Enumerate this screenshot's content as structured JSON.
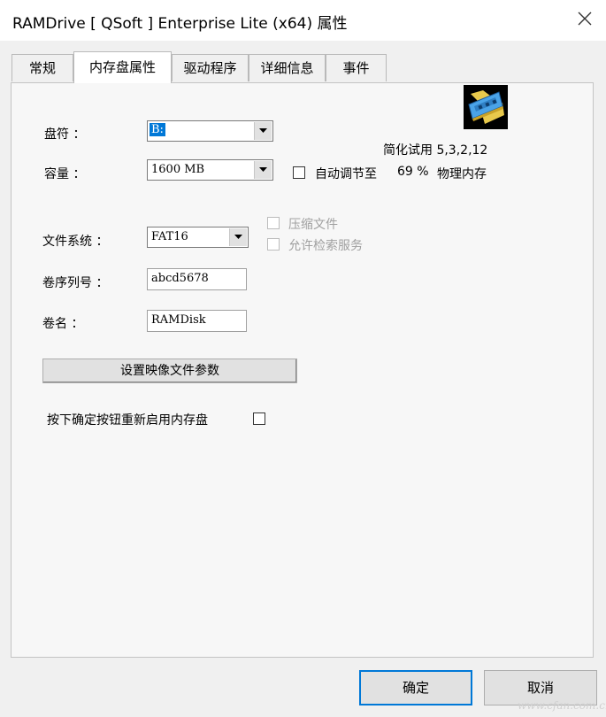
{
  "window": {
    "title": "RAMDrive [ QSoft ] Enterprise Lite (x64) 属性"
  },
  "tabs": [
    {
      "label": "常规",
      "active": false
    },
    {
      "label": "内存盘属性",
      "active": true
    },
    {
      "label": "驱动程序",
      "active": false
    },
    {
      "label": "详细信息",
      "active": false
    },
    {
      "label": "事件",
      "active": false
    }
  ],
  "panel": {
    "trial_label": "简化试用 5,3,2,12",
    "drive_letter": {
      "label": "盘符 ：",
      "value": "B:"
    },
    "capacity": {
      "label": "容量 ：",
      "value": "1600 MB"
    },
    "auto_adjust": {
      "label": "自动调节至",
      "percent": "69 %",
      "suffix": "物理内存",
      "checked": false
    },
    "filesystem": {
      "label": "文件系统 ：",
      "value": "FAT16"
    },
    "compress": {
      "label": "压缩文件",
      "checked": false,
      "enabled": false
    },
    "indexing": {
      "label": "允许检索服务",
      "checked": false,
      "enabled": false
    },
    "serial": {
      "label": "卷序列号 ：",
      "value": "abcd5678"
    },
    "volume_name": {
      "label": "卷名 ：",
      "value": "RAMDisk"
    },
    "image_button_label": "设置映像文件参数",
    "restart_label": "按下确定按钮重新启用内存盘",
    "restart_checked": false
  },
  "footer": {
    "ok_label": "确定",
    "cancel_label": "取消"
  },
  "watermark": "www.cfan.com.cn",
  "colors": {
    "accent": "#0078d7",
    "panel": "#f7f7f7",
    "window": "#f0f0f0"
  },
  "icons": [
    "close-icon",
    "ram-chip-icon",
    "dropdown-arrow-icon"
  ]
}
